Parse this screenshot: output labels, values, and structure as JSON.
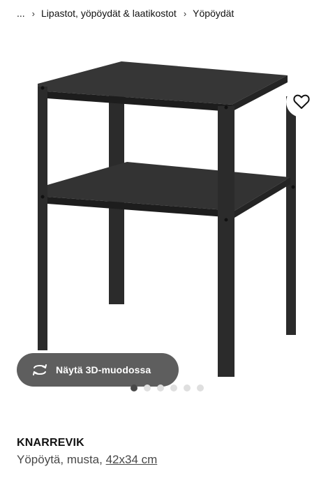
{
  "breadcrumb": {
    "ellipsis": "...",
    "items": [
      "Lipastot, yöpöydät & laatikostot",
      "Yöpöydät"
    ],
    "separator_icon": "chevron-right-icon"
  },
  "gallery": {
    "view_3d_label": "Näytä 3D-muodossa",
    "view_3d_icon": "rotate-3d-icon",
    "favorite_icon": "heart-icon",
    "slide_count": 6,
    "active_slide": 1,
    "product_color": "#2b2b2b"
  },
  "product": {
    "name": "KNARREVIK",
    "description": "Yöpöytä, musta,",
    "size": "42x34 cm"
  }
}
